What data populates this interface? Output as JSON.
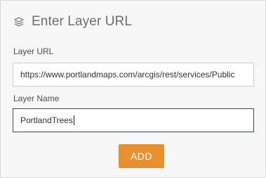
{
  "header": {
    "title": "Enter Layer URL",
    "icon": "layers-icon"
  },
  "form": {
    "url_label": "Layer URL",
    "url_value": "https://www.portlandmaps.com/arcgis/rest/services/Public",
    "name_label": "Layer Name",
    "name_value": "PortlandTrees"
  },
  "actions": {
    "add_label": "ADD"
  },
  "colors": {
    "accent": "#e8902f",
    "focus_border": "#3a4b66",
    "panel_bg": "#f7f7f7"
  }
}
